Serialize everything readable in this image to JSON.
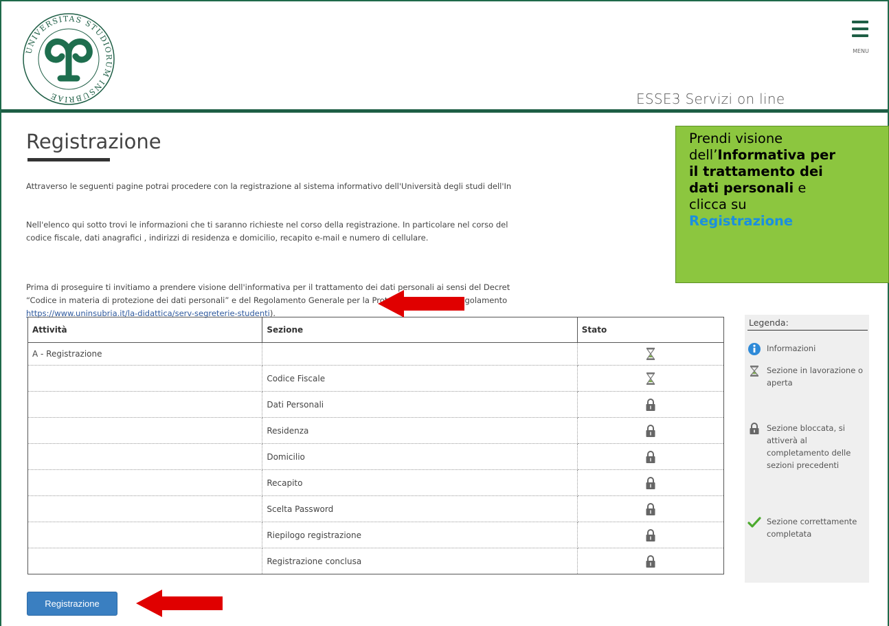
{
  "header": {
    "logo": {
      "seal_text": "UNIVERSITAS STUDIORUM INSUBRIAE"
    },
    "menu_label": "MENU",
    "app_title": "ESSE3 Servizi on line"
  },
  "page": {
    "title": "Registrazione",
    "paragraph1": "Attraverso le seguenti pagine potrai procedere con la registrazione al sistema informativo dell'Università degli studi dell'In",
    "paragraph2_line1": "Nell'elenco qui sotto trovi le informazioni che ti saranno richieste nel corso della registrazione. In particolare nel corso del",
    "paragraph2_line2": "codice fiscale, dati anagrafici , indirizzi di residenza e domicilio, recapito e-mail e numero di cellulare.",
    "paragraph3_line1": "Prima di proseguire ti invitiamo a prendere visione dell'informativa per il trattamento dei dati personali ai sensi del Decret",
    "paragraph3_line2": "“Codice in materia di protezione dei dati personali” e del Regolamento Generale per la Protezione dei Dati - Regolamento",
    "paragraph3_link": "https://www.uninsubria.it/la-didattica/serv-segreterie-studenti",
    "paragraph3_end": ")."
  },
  "table": {
    "headers": [
      "Attività",
      "Sezione",
      "Stato"
    ],
    "rows": [
      {
        "attivita": "A - Registrazione",
        "sezione": "",
        "stato": "hourglass-icon"
      },
      {
        "attivita": "",
        "sezione": "Codice Fiscale",
        "stato": "hourglass-icon"
      },
      {
        "attivita": "",
        "sezione": "Dati Personali",
        "stato": "lock-icon"
      },
      {
        "attivita": "",
        "sezione": "Residenza",
        "stato": "lock-icon"
      },
      {
        "attivita": "",
        "sezione": "Domicilio",
        "stato": "lock-icon"
      },
      {
        "attivita": "",
        "sezione": "Recapito",
        "stato": "lock-icon"
      },
      {
        "attivita": "",
        "sezione": "Scelta Password",
        "stato": "lock-icon"
      },
      {
        "attivita": "",
        "sezione": "Riepilogo registrazione",
        "stato": "lock-icon"
      },
      {
        "attivita": "",
        "sezione": "Registrazione conclusa",
        "stato": "lock-icon"
      }
    ]
  },
  "legend": {
    "title": "Legenda:",
    "items": [
      {
        "icon": "info-icon",
        "text": "Informazioni"
      },
      {
        "icon": "hourglass-icon",
        "text": "Sezione in lavorazione o aperta"
      },
      {
        "icon": "lock-icon",
        "text": "Sezione bloccata, si attiverà al completamento delle sezioni precedenti"
      },
      {
        "icon": "checkmark-icon",
        "text": "Sezione correttamente completata"
      }
    ]
  },
  "button": {
    "label": "Registrazione"
  },
  "callout": {
    "line1": "Prendi visione",
    "line2_normal": "dell’",
    "line2_bold": "Informativa per",
    "line3": "il trattamento dei",
    "line4_bold": "dati personali",
    "line4_normal": " e",
    "line5": "clicca su",
    "line6": "Registrazione"
  },
  "colors": {
    "brand_green": "#1e5e45",
    "callout_green": "#8cc63f",
    "button_blue": "#3a7fc1",
    "arrow_red": "#e00000",
    "callout_highlight": "#1a8fe0"
  }
}
